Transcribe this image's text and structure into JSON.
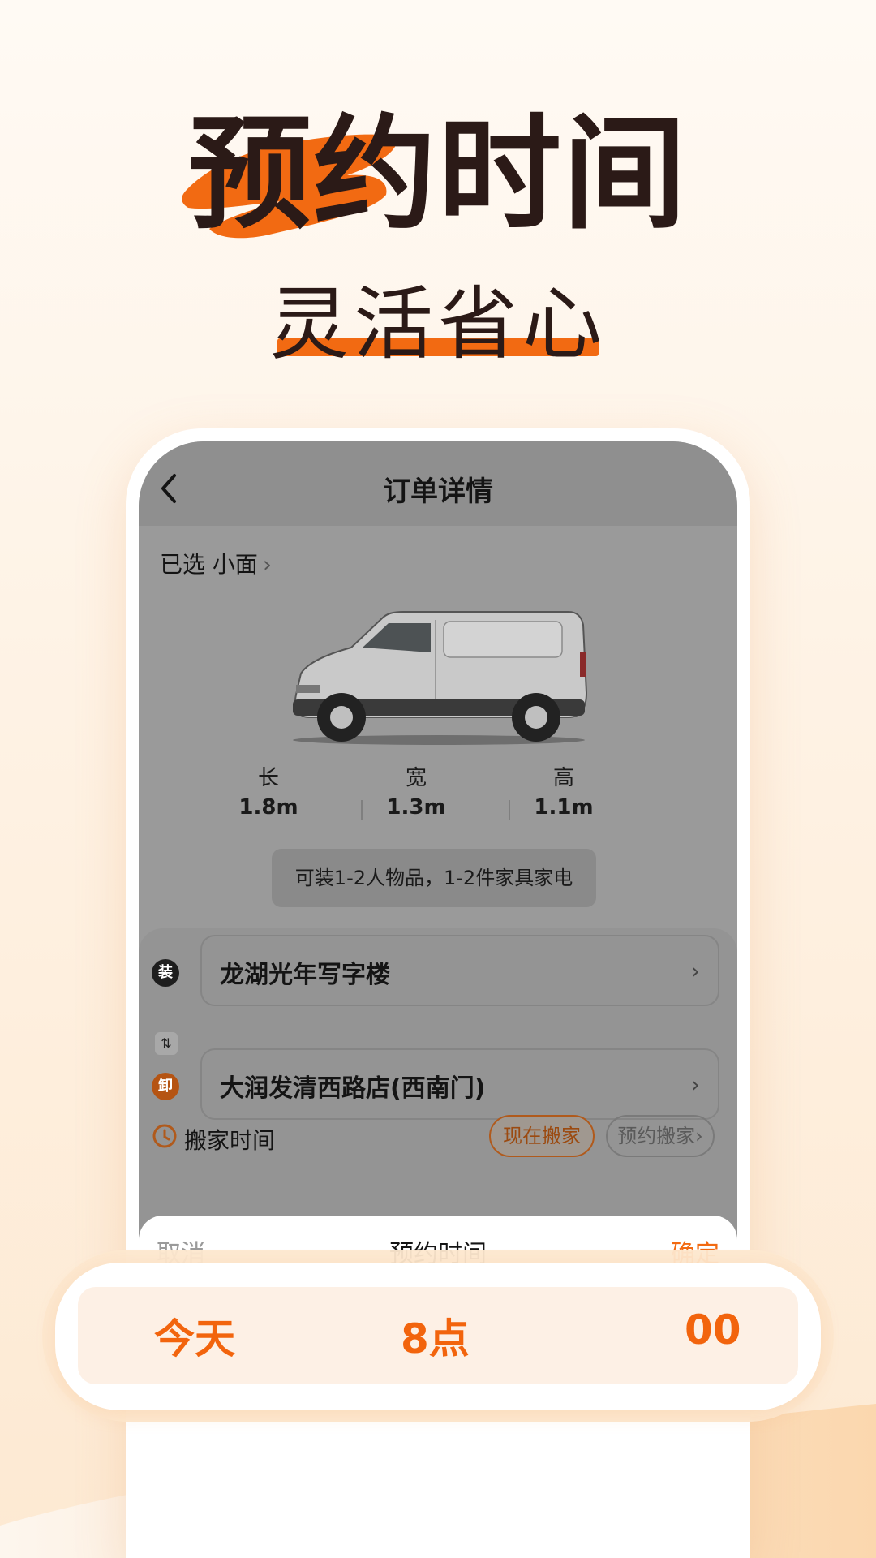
{
  "hero": {
    "title": "预约时间",
    "subtitle": "灵活省心"
  },
  "colors": {
    "accent": "#f26a12",
    "title_dark": "#2b1a17",
    "background": "#fef2e4"
  },
  "nav": {
    "title": "订单详情",
    "back_icon": "chevron-left-icon"
  },
  "vehicle": {
    "selected_label": "已选 小面",
    "chevron": "›",
    "dimensions": [
      {
        "key": "长",
        "value": "1.8m"
      },
      {
        "key": "宽",
        "value": "1.3m"
      },
      {
        "key": "高",
        "value": "1.1m"
      }
    ],
    "capacity": "可装1-2人物品，1-2件家具家电"
  },
  "addresses": {
    "load_badge": "装",
    "load_address": "龙湖光年写字楼",
    "swap_icon": "⇅",
    "unload_badge": "卸",
    "unload_address": "大润发清西路店(西南门)",
    "arrow": "›"
  },
  "move_time": {
    "label": "搬家时间",
    "now_button": "现在搬家",
    "book_button": "预约搬家›"
  },
  "sheet": {
    "cancel": "取消",
    "title": "预约时间",
    "confirm": "确定",
    "row": {
      "day": "今天",
      "hour": "8点",
      "minute": "00"
    }
  },
  "picker_highlight": {
    "day": "今天",
    "hour": "8点",
    "minute": "00"
  }
}
